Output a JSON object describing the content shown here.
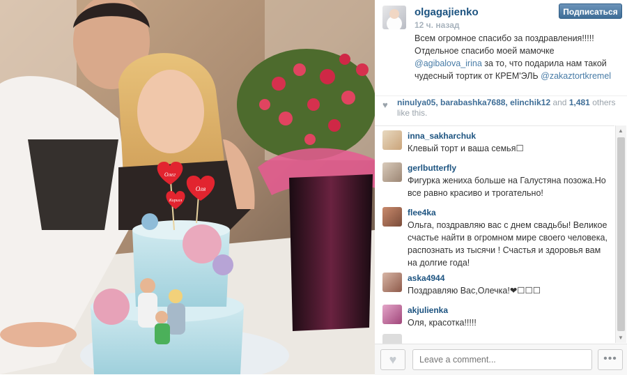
{
  "post": {
    "username": "olgagajienko",
    "time": "12 ч. назад",
    "follow_label": "Подписаться",
    "caption_1": "Всем огромное спасибо за поздравления!!!!! Отдельное спасибо моей мамочке ",
    "caption_mention_1": "@agibalova_irina",
    "caption_2": " за то, что подарила нам такой чудесный тортик от КРЕМ'ЭЛЬ ",
    "caption_mention_2": "@zakaztortkremel"
  },
  "likes": {
    "names": "ninulya05, barabashka7688, elinchik12",
    "and": " and ",
    "count": "1,481",
    "suffix": " others like this."
  },
  "comments": [
    {
      "user": "inna_sakharchuk",
      "text": "Клевый торт и ваша семья☐"
    },
    {
      "user": "gerlbutterfly",
      "text": "Фигурка жениха больше на Галустяна позожа.Но все равно красиво и трогательно!"
    },
    {
      "user": "flee4ka",
      "text": "Ольга, поздравляю вас с днем свадьбы! Великое счастье найти в огромном мире своего человека, распознать из тысячи ! Счастья и здоровья вам на долгие года!"
    },
    {
      "user": "aska4944",
      "text": "Поздравляю Вас,Олечка!❤☐☐☐"
    },
    {
      "user": "akjulienka",
      "text": "Оля, красотка!!!!!"
    }
  ],
  "cake_hearts": [
    "Олег",
    "Оля",
    "Кирилл"
  ],
  "comment_input": {
    "placeholder": "Leave a comment..."
  },
  "more_label": "•••",
  "icons": {
    "heart": "heart-icon",
    "more": "ellipsis-icon"
  },
  "colors": {
    "accent": "#3f6e97",
    "username": "#1c5380",
    "muted": "#9aa3ab"
  }
}
